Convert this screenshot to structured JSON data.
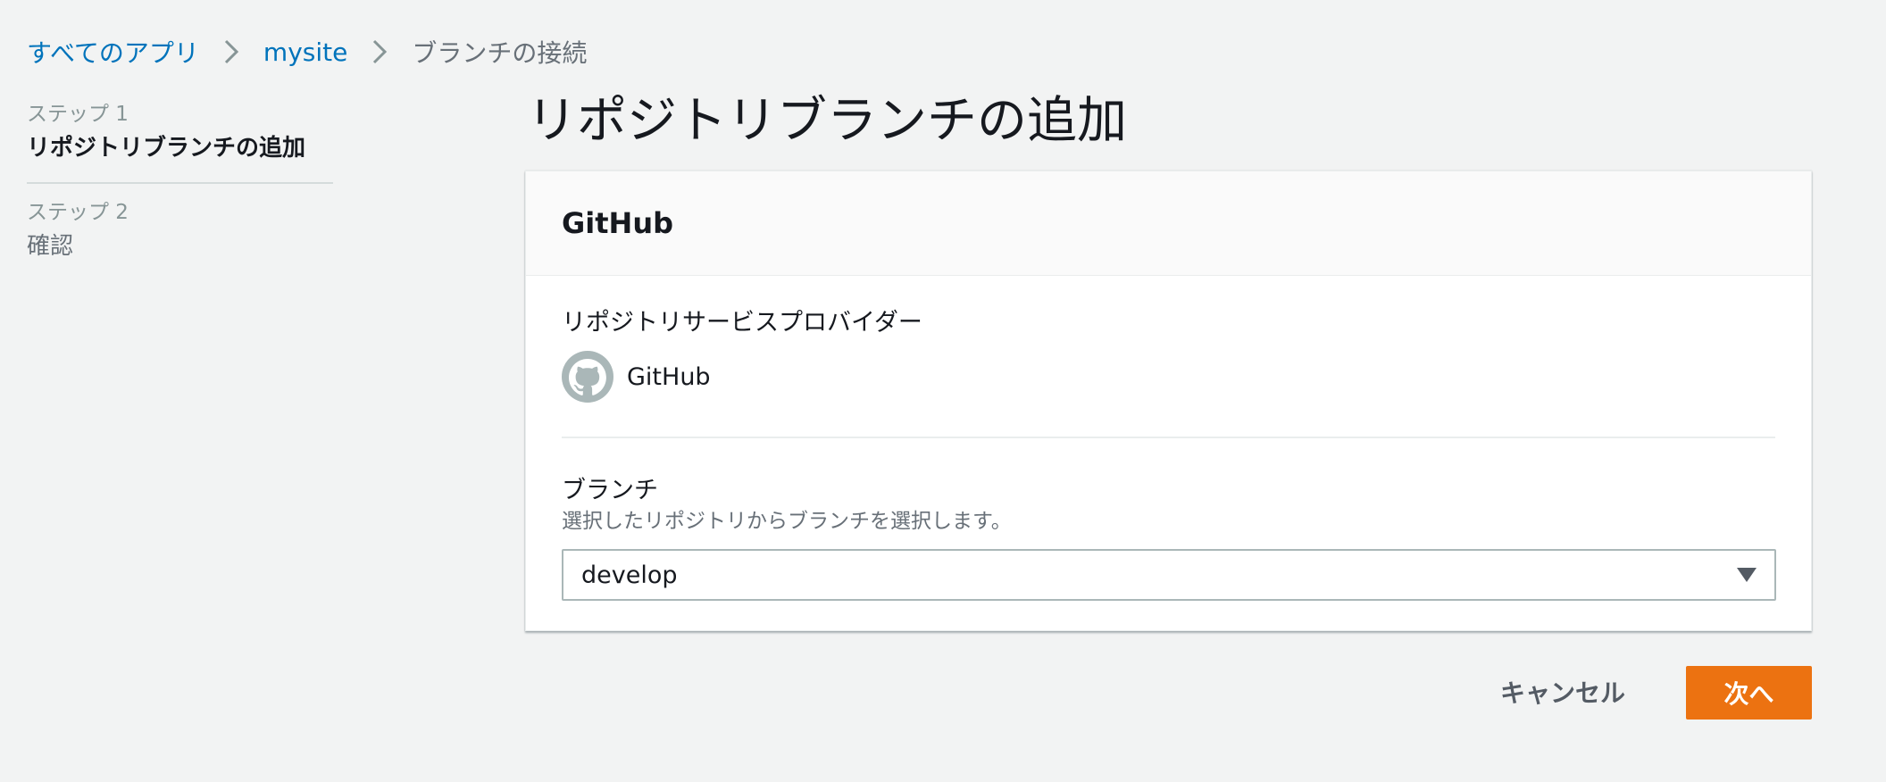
{
  "breadcrumb": {
    "items": [
      {
        "label": "すべてのアプリ"
      },
      {
        "label": "mysite"
      },
      {
        "label": "ブランチの接続"
      }
    ]
  },
  "steps": [
    {
      "number": "ステップ 1",
      "title": "リポジトリブランチの追加",
      "active": true
    },
    {
      "number": "ステップ 2",
      "title": "確認",
      "active": false
    }
  ],
  "page": {
    "title": "リポジトリブランチの追加"
  },
  "card": {
    "header_title": "GitHub",
    "provider": {
      "label": "リポジトリサービスプロバイダー",
      "name": "GitHub",
      "icon": "github-icon"
    },
    "branch": {
      "label": "ブランチ",
      "description": "選択したリポジトリからブランチを選択します。",
      "selected": "develop",
      "icon": "caret-down-icon"
    }
  },
  "actions": {
    "cancel_label": "キャンセル",
    "next_label": "次へ"
  },
  "colors": {
    "link": "#0073bb",
    "primary": "#ec7211",
    "background": "#f2f3f3"
  }
}
